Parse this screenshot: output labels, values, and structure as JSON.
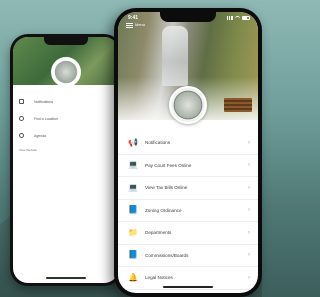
{
  "back_phone": {
    "items": [
      {
        "icon": "grid-icon",
        "label": "Notifications"
      },
      {
        "icon": "location-pin-icon",
        "label": "Find a Location"
      },
      {
        "icon": "info-icon",
        "label": "Agenda"
      }
    ],
    "footer": "View Website"
  },
  "front_phone": {
    "status_time": "9:41",
    "menu_label": "Menu",
    "menu_items": [
      {
        "name": "notifications",
        "icon": "megaphone-icon",
        "glyph": "📢",
        "label": "Notifications"
      },
      {
        "name": "pay-court-fees",
        "icon": "laptop-icon",
        "glyph": "💻",
        "label": "Pay Court Fees Online"
      },
      {
        "name": "view-tax-bills",
        "icon": "laptop-icon",
        "glyph": "💻",
        "label": "View Tax Bills Online"
      },
      {
        "name": "zoning-ordinance",
        "icon": "document-icon",
        "glyph": "📘",
        "label": "Zoning Ordinance"
      },
      {
        "name": "departments",
        "icon": "folder-icon",
        "glyph": "📁",
        "label": "Departments"
      },
      {
        "name": "commissions-boards",
        "icon": "document-icon",
        "glyph": "📘",
        "label": "Commissions/Boards"
      },
      {
        "name": "legal-notices",
        "icon": "bell-icon",
        "glyph": "🔔",
        "label": "Legal Notices"
      }
    ],
    "chevron": "›"
  },
  "colors": {
    "accent": "#1e5fbf",
    "background_teal": "#6e9d9a"
  }
}
